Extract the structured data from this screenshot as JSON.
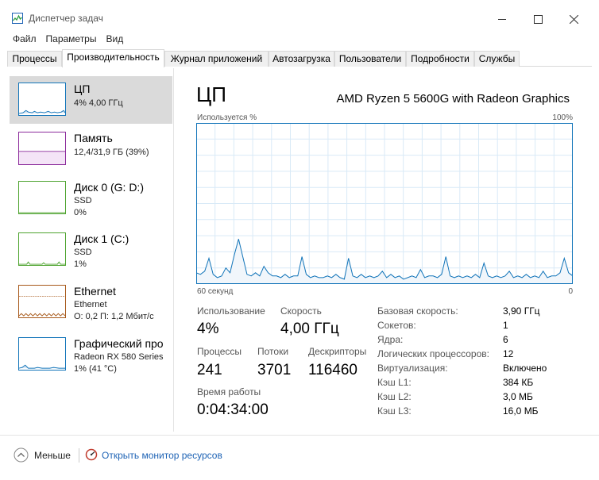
{
  "window": {
    "title": "Диспетчер задач"
  },
  "menu": [
    "Файл",
    "Параметры",
    "Вид"
  ],
  "tabs": [
    "Процессы",
    "Производительность",
    "Журнал приложений",
    "Автозагрузка",
    "Пользователи",
    "Подробности",
    "Службы"
  ],
  "active_tab": "Производительность",
  "resources": [
    {
      "name": "ЦП",
      "sub1": "4% 4,00 ГГц",
      "sub2": "",
      "color": "#1174b9"
    },
    {
      "name": "Память",
      "sub1": "12,4/31,9 ГБ (39%)",
      "sub2": "",
      "color": "#8b2a9b"
    },
    {
      "name": "Диск 0 (G: D:)",
      "sub1": "SSD",
      "sub2": "0%",
      "color": "#4da32e"
    },
    {
      "name": "Диск 1 (C:)",
      "sub1": "SSD",
      "sub2": "1%",
      "color": "#4da32e"
    },
    {
      "name": "Ethernet",
      "sub1": "Ethernet",
      "sub2": "О: 0,2  П: 1,2 Мбит/с",
      "color": "#a7591a"
    },
    {
      "name": "Графический про",
      "sub1": "Radeon RX 580 Series",
      "sub2": "1% (41 °C)",
      "color": "#1174b9"
    }
  ],
  "main": {
    "title": "ЦП",
    "model": "AMD Ryzen 5 5600G with Radeon Graphics",
    "graph_top_left": "Используется %",
    "graph_top_right": "100%",
    "graph_bottom_left": "60 секунд",
    "graph_bottom_right": "0"
  },
  "chart_data": {
    "type": "area",
    "ylim": [
      0,
      100
    ],
    "xlim": [
      60,
      0
    ],
    "grid": true,
    "series": [
      {
        "values": [
          7,
          6,
          8,
          16,
          6,
          4,
          5,
          10,
          7,
          18,
          28,
          17,
          6,
          5,
          7,
          5,
          11,
          7,
          5,
          5,
          4,
          6,
          4,
          5,
          5,
          17,
          6,
          4,
          5,
          4,
          4,
          5,
          4,
          6,
          4,
          3,
          16,
          5,
          4,
          6,
          4,
          5,
          4,
          5,
          8,
          4,
          6,
          4,
          5,
          3,
          4,
          5,
          4,
          9,
          4,
          5,
          5,
          4,
          6,
          17,
          5,
          4,
          5,
          4,
          5,
          4,
          6,
          4,
          13,
          5,
          4,
          5,
          4,
          5,
          8,
          4,
          5,
          4,
          6,
          4,
          5,
          4,
          8,
          4,
          5,
          5,
          7,
          16,
          7,
          5
        ]
      }
    ]
  },
  "stats": {
    "utilization_label": "Использование",
    "utilization_value": "4%",
    "speed_label": "Скорость",
    "speed_value": "4,00 ГГц",
    "processes_label": "Процессы",
    "processes_value": "241",
    "threads_label": "Потоки",
    "threads_value": "3701",
    "handles_label": "Дескрипторы",
    "handles_value": "116460",
    "uptime_label": "Время работы",
    "uptime_value": "0:04:34:00"
  },
  "specs": [
    {
      "label": "Базовая скорость:",
      "value": "3,90 ГГц"
    },
    {
      "label": "Сокетов:",
      "value": "1"
    },
    {
      "label": "Ядра:",
      "value": "6"
    },
    {
      "label": "Логических процессоров:",
      "value": "12"
    },
    {
      "label": "Виртуализация:",
      "value": "Включено"
    },
    {
      "label": "Кэш L1:",
      "value": "384 КБ"
    },
    {
      "label": "Кэш L2:",
      "value": "3,0 МБ"
    },
    {
      "label": "Кэш L3:",
      "value": "16,0 МБ"
    }
  ],
  "footer": {
    "less_label": "Меньше",
    "monitor_link": "Открыть монитор ресурсов"
  }
}
